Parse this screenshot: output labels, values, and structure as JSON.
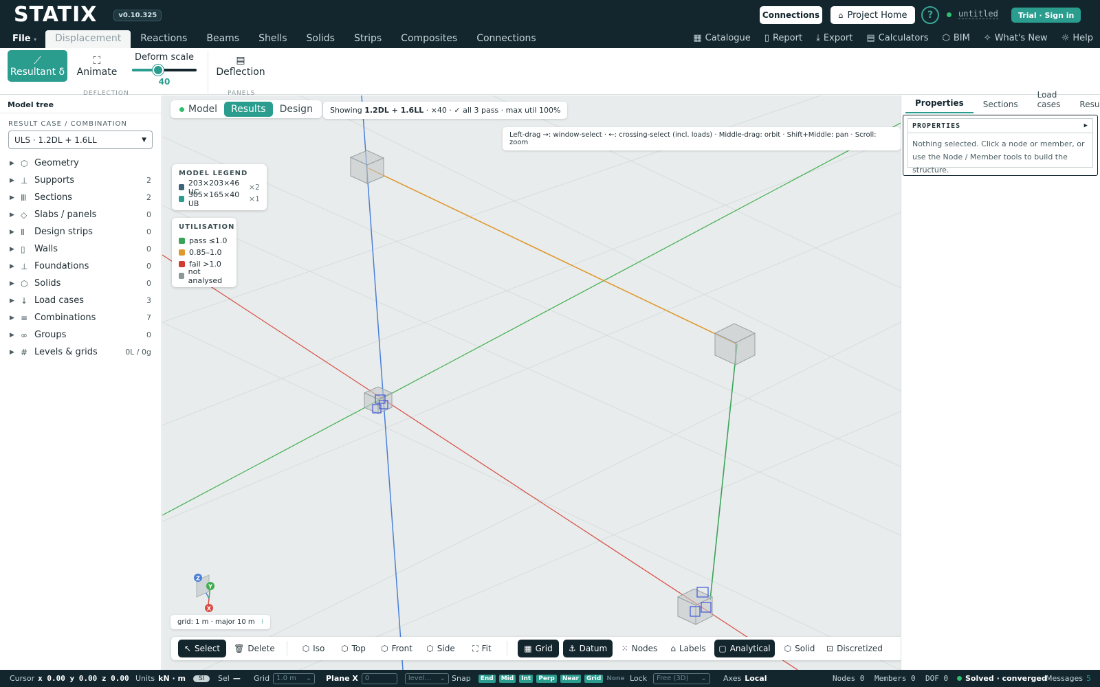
{
  "app": {
    "logo": "STATIX",
    "version": "v0.10.325"
  },
  "topbar": {
    "connections": "Connections",
    "project_home": "Project Home",
    "help": "?",
    "file_name": "untitled",
    "trial": "Trial · Sign in"
  },
  "menu": {
    "file": "File",
    "tabs": [
      "Displacement",
      "Reactions",
      "Beams",
      "Shells",
      "Solids",
      "Strips",
      "Composites",
      "Connections"
    ],
    "active_tab": "Displacement",
    "right": [
      "Catalogue",
      "Report",
      "Export",
      "Calculators",
      "BIM",
      "What's New",
      "Help"
    ]
  },
  "ribbon": {
    "resultant": "Resultant δ",
    "animate": "Animate",
    "deform_label": "Deform scale",
    "deform_value": "40",
    "deform_fraction": 0.4,
    "deflection": "Deflection",
    "group1": "DEFLECTION",
    "group2": "PANELS"
  },
  "left": {
    "title": "Model tree",
    "result_label": "RESULT CASE / COMBINATION",
    "result_value": "ULS · 1.2DL + 1.6LL",
    "items": [
      {
        "label": "Geometry",
        "count": "",
        "icon": "cube-icon"
      },
      {
        "label": "Supports",
        "count": "2",
        "icon": "support-icon"
      },
      {
        "label": "Sections",
        "count": "2",
        "icon": "section-icon"
      },
      {
        "label": "Slabs / panels",
        "count": "0",
        "icon": "layers-icon"
      },
      {
        "label": "Design strips",
        "count": "0",
        "icon": "strip-icon"
      },
      {
        "label": "Walls",
        "count": "0",
        "icon": "wall-icon"
      },
      {
        "label": "Foundations",
        "count": "0",
        "icon": "foundation-icon"
      },
      {
        "label": "Solids",
        "count": "0",
        "icon": "solid-icon"
      },
      {
        "label": "Load cases",
        "count": "3",
        "icon": "load-icon"
      },
      {
        "label": "Combinations",
        "count": "7",
        "icon": "list-icon"
      },
      {
        "label": "Groups",
        "count": "0",
        "icon": "group-icon"
      },
      {
        "label": "Levels & grids",
        "count": "0L / 0g",
        "icon": "grid-icon"
      }
    ]
  },
  "viewport": {
    "modes": [
      "Model",
      "Results",
      "Design"
    ],
    "active_mode": "Results",
    "showing_prefix": "Showing",
    "showing_case": "1.2DL + 1.6LL",
    "showing_rest": "· ×40 · ✓ all 3 pass · max util 100%",
    "hint": "Left-drag →: window-select · ←: crossing-select (incl. loads) · Middle-drag: orbit · Shift+Middle: pan · Scroll: zoom",
    "legend_title": "MODEL LEGEND",
    "legend": [
      {
        "label": "203×203×46 UC",
        "count": "×2",
        "color": "#3d6478"
      },
      {
        "label": "305×165×40 UB",
        "count": "×1",
        "color": "#2a9d8f"
      }
    ],
    "util_title": "UTILISATION",
    "util": [
      {
        "label": "pass ≤1.0",
        "color": "#3aa35a"
      },
      {
        "label": "0.85–1.0",
        "color": "#e0982e"
      },
      {
        "label": "fail >1.0",
        "color": "#d13b32"
      },
      {
        "label": "not analysed",
        "color": "#8d979a"
      }
    ],
    "axes": {
      "z": "Z",
      "y": "Y",
      "x": "X"
    },
    "grid_info": "grid: 1 m · major 10 m"
  },
  "bottom_toolbar": [
    "Select",
    "Delete",
    "Iso",
    "Top",
    "Front",
    "Side",
    "Fit",
    "Grid",
    "Datum",
    "Nodes",
    "Labels",
    "Analytical",
    "Solid",
    "Discretized"
  ],
  "right": {
    "tabs": [
      "Properties",
      "Sections",
      "Load cases",
      "Results"
    ],
    "active_tab": "Properties",
    "box_title": "PROPERTIES",
    "box_text": "Nothing selected. Click a node or member, or use the Node / Member tools to build the structure."
  },
  "status": {
    "cursor_label": "Cursor",
    "cursor": "x 0.00 y 0.00 z 0.00",
    "units_label": "Units",
    "units": "kN · m",
    "units_badge": "SI",
    "sel_label": "Sel",
    "sel": "—",
    "grid_label": "Grid",
    "grid_value": "1.0 m",
    "plane_label": "Plane X",
    "plane_value": "0",
    "level_value": "level…",
    "snap_label": "Snap",
    "snaps": [
      "End",
      "Mid",
      "Int",
      "Perp",
      "Near",
      "Grid"
    ],
    "snap_none": "None",
    "lock_label": "Lock",
    "lock_value": "Free (3D)",
    "axes_label": "Axes",
    "axes_value": "Local",
    "nodes": "Nodes 0",
    "members": "Members 0",
    "dof": "DOF 0",
    "solved": "Solved · converged",
    "messages": "Messages",
    "messages_count": "5"
  },
  "colors": {
    "dark": "#13262e",
    "teal": "#2a9d8f",
    "axis_x": "#d94b43",
    "axis_y": "#3fae4d",
    "axis_z": "#4a7fd8",
    "beam": "#e0982e",
    "column": "#3aa35a"
  }
}
